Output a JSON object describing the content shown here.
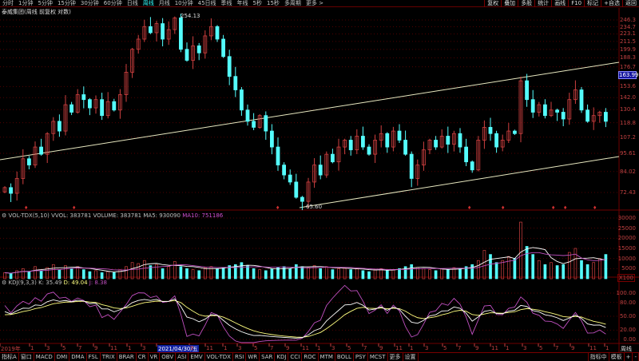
{
  "topbar": {
    "tabs": [
      "分时",
      "1分钟",
      "5分钟",
      "15分钟",
      "30分钟",
      "60分钟",
      "日线",
      "周线",
      "月线",
      "10分钟",
      "45日线",
      "季线",
      "年线",
      "5秒",
      "15秒",
      "多周期",
      "更多 >"
    ],
    "active": "周线",
    "buttons": [
      "复权",
      "叠加",
      "多股",
      "统计",
      "画线",
      "F10",
      "标记",
      "+自选",
      "返回"
    ]
  },
  "title": "泰威集团(周线 前复权 对数)",
  "price_axis": [
    "246.3",
    "234.7",
    "223.1",
    "211.5",
    "199.9",
    "188.3",
    "176.7",
    "153.6",
    "142.0",
    "130.4",
    "118.8",
    "107.2",
    "95.61",
    "84.02",
    "72.43"
  ],
  "current_price": "163.99",
  "high_label": "254.13",
  "low_label": "65.60",
  "volume_header": {
    "name": "VOL-TDX(5,10)",
    "vvol": "VVOL: 383781",
    "volume": "VOLUME: 383781",
    "ma5": "MA5: 930090",
    "ma10": "MA10: 751186"
  },
  "volume_axis": [
    "30000",
    "25000",
    "20000",
    "15000",
    "10000",
    "5000"
  ],
  "volume_unit": "X100",
  "kdj_header": {
    "name": "KDJ(9,3,3)",
    "k": "K: 35.49",
    "d": "D: 49.04",
    "j": "J: 8.38"
  },
  "kdj_axis": [
    "100.00",
    "80.00",
    "50.00",
    "20.00",
    "0.00"
  ],
  "time_axis": [
    "2019年",
    "1",
    "3",
    "5",
    "7",
    "9",
    "11",
    "1",
    "3",
    "2021/04/30/五",
    "9",
    "11",
    "1",
    "3",
    "5",
    "7",
    "9",
    "11",
    "1",
    "3",
    "5",
    "7",
    "9",
    "11",
    "1",
    "3",
    "5",
    "7",
    "9",
    "11",
    "1",
    "3",
    "5",
    "7",
    "9",
    "11",
    "1"
  ],
  "period_label": "周线",
  "bottom_tabs": [
    "指标A",
    "窗口",
    "MACD",
    "DMI",
    "DMA",
    "FSL",
    "TRIX",
    "BRAR",
    "CR",
    "VR",
    "OBV",
    "ASI",
    "EMV",
    "VOL-TDX",
    "RSI",
    "WR",
    "SAR",
    "KDJ",
    "CCI",
    "ROC",
    "MTM",
    "BOLL",
    "PSY",
    "MCST",
    "更多",
    "设置"
  ],
  "bottom_right": [
    "指标中",
    "模板",
    "+",
    "-"
  ],
  "colors": {
    "up": "#d04040",
    "down": "#54fcfc",
    "grid": "#700000",
    "kline": "#ffffff",
    "dline": "#ffff80",
    "jline": "#c050c0"
  },
  "chart_data": {
    "type": "candlestick",
    "scale": "log",
    "ylim": [
      72.43,
      246.3
    ],
    "closes": [
      75,
      72,
      80,
      92,
      88,
      100,
      95,
      110,
      120,
      112,
      135,
      128,
      145,
      140,
      132,
      140,
      125,
      138,
      130,
      145,
      170,
      200,
      215,
      235,
      225,
      240,
      215,
      230,
      250,
      200,
      185,
      205,
      195,
      220,
      235,
      215,
      190,
      165,
      150,
      130,
      120,
      115,
      125,
      112,
      100,
      88,
      82,
      78,
      70,
      68,
      78,
      88,
      82,
      95,
      90,
      100,
      105,
      98,
      108,
      100,
      95,
      105,
      110,
      100,
      112,
      105,
      95,
      80,
      88,
      98,
      105,
      100,
      108,
      102,
      110,
      100,
      90,
      85,
      105,
      115,
      110,
      100,
      105,
      112,
      110,
      160,
      140,
      128,
      135,
      125,
      130,
      128,
      122,
      140,
      150,
      130,
      120,
      125,
      128,
      120
    ],
    "volumes": [
      3000,
      2500,
      4000,
      5000,
      3500,
      6000,
      4000,
      5500,
      7000,
      4500,
      6500,
      5000,
      6000,
      4500,
      3500,
      4000,
      3000,
      3500,
      3000,
      4500,
      6000,
      8000,
      7500,
      9000,
      6500,
      7000,
      5000,
      6000,
      8500,
      6000,
      5000,
      4500,
      4000,
      5500,
      6000,
      5000,
      5500,
      6500,
      7000,
      8000,
      6500,
      5000,
      4500,
      4000,
      5000,
      5500,
      6000,
      5000,
      7000,
      6000,
      5500,
      6500,
      5000,
      6000,
      4500,
      5000,
      5500,
      4500,
      5000,
      4000,
      3500,
      4500,
      5000,
      4000,
      4500,
      5000,
      6000,
      7000,
      5500,
      5000,
      4500,
      4000,
      5000,
      4500,
      5500,
      5000,
      6000,
      7000,
      9000,
      14000,
      12000,
      8000,
      9000,
      11000,
      10000,
      28000,
      16000,
      12000,
      9000,
      7000,
      8000,
      6500,
      7000,
      13000,
      15000,
      9000,
      7000,
      8000,
      10000,
      12000
    ]
  }
}
